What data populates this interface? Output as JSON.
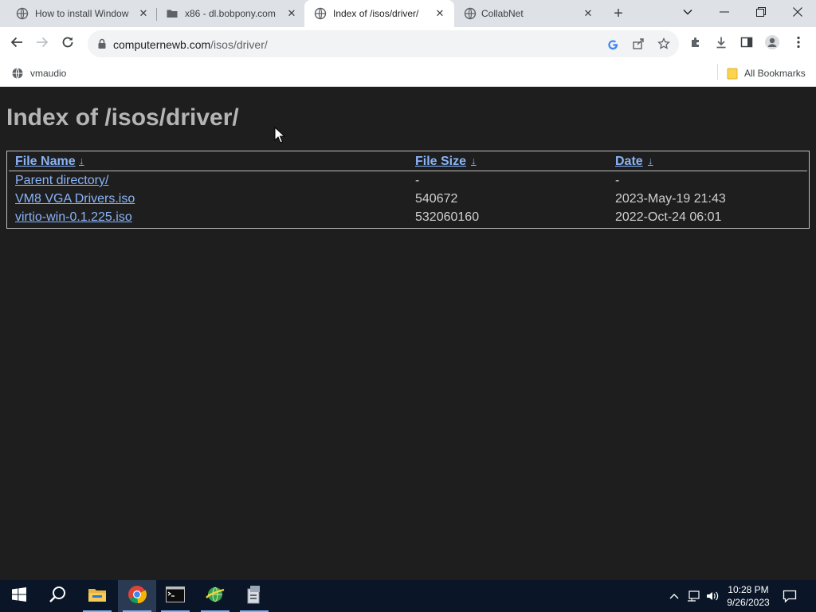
{
  "browser": {
    "tabs": [
      {
        "title": "How to install Window",
        "favicon": "globe-icon"
      },
      {
        "title": "x86 - dl.bobpony.com",
        "favicon": "folder-icon"
      },
      {
        "title": "Index of /isos/driver/",
        "favicon": "globe-icon"
      },
      {
        "title": "CollabNet",
        "favicon": "globe-icon"
      }
    ],
    "active_tab_index": 2,
    "url_host": "computernewb.com",
    "url_path": "/isos/driver/",
    "bookmarks": [
      {
        "label": "vmaudio",
        "icon": "globe-icon"
      }
    ],
    "all_bookmarks_label": "All Bookmarks"
  },
  "page": {
    "title": "Index of /isos/driver/",
    "columns": [
      {
        "label": "File Name",
        "sort": "↓"
      },
      {
        "label": "File Size",
        "sort": "↓"
      },
      {
        "label": "Date",
        "sort": "↓"
      }
    ],
    "rows": [
      {
        "name": "Parent directory/",
        "size": "-",
        "date": "-"
      },
      {
        "name": "VM8 VGA Drivers.iso",
        "size": "540672",
        "date": "2023-May-19 21:43"
      },
      {
        "name": "virtio-win-0.1.225.iso",
        "size": "532060160",
        "date": "2022-Oct-24 06:01"
      }
    ]
  },
  "taskbar": {
    "apps": [
      "start-icon",
      "search-icon",
      "file-explorer-icon",
      "chrome-icon",
      "terminal-icon",
      "network-globe-icon",
      "installer-icon"
    ],
    "time": "10:28 PM",
    "date": "9/26/2023"
  },
  "colors": {
    "page_bg": "#1e1e1e",
    "link": "#8ab4f8",
    "title_text": "#b5b5b5",
    "taskbar_bg": "#0a1628"
  }
}
